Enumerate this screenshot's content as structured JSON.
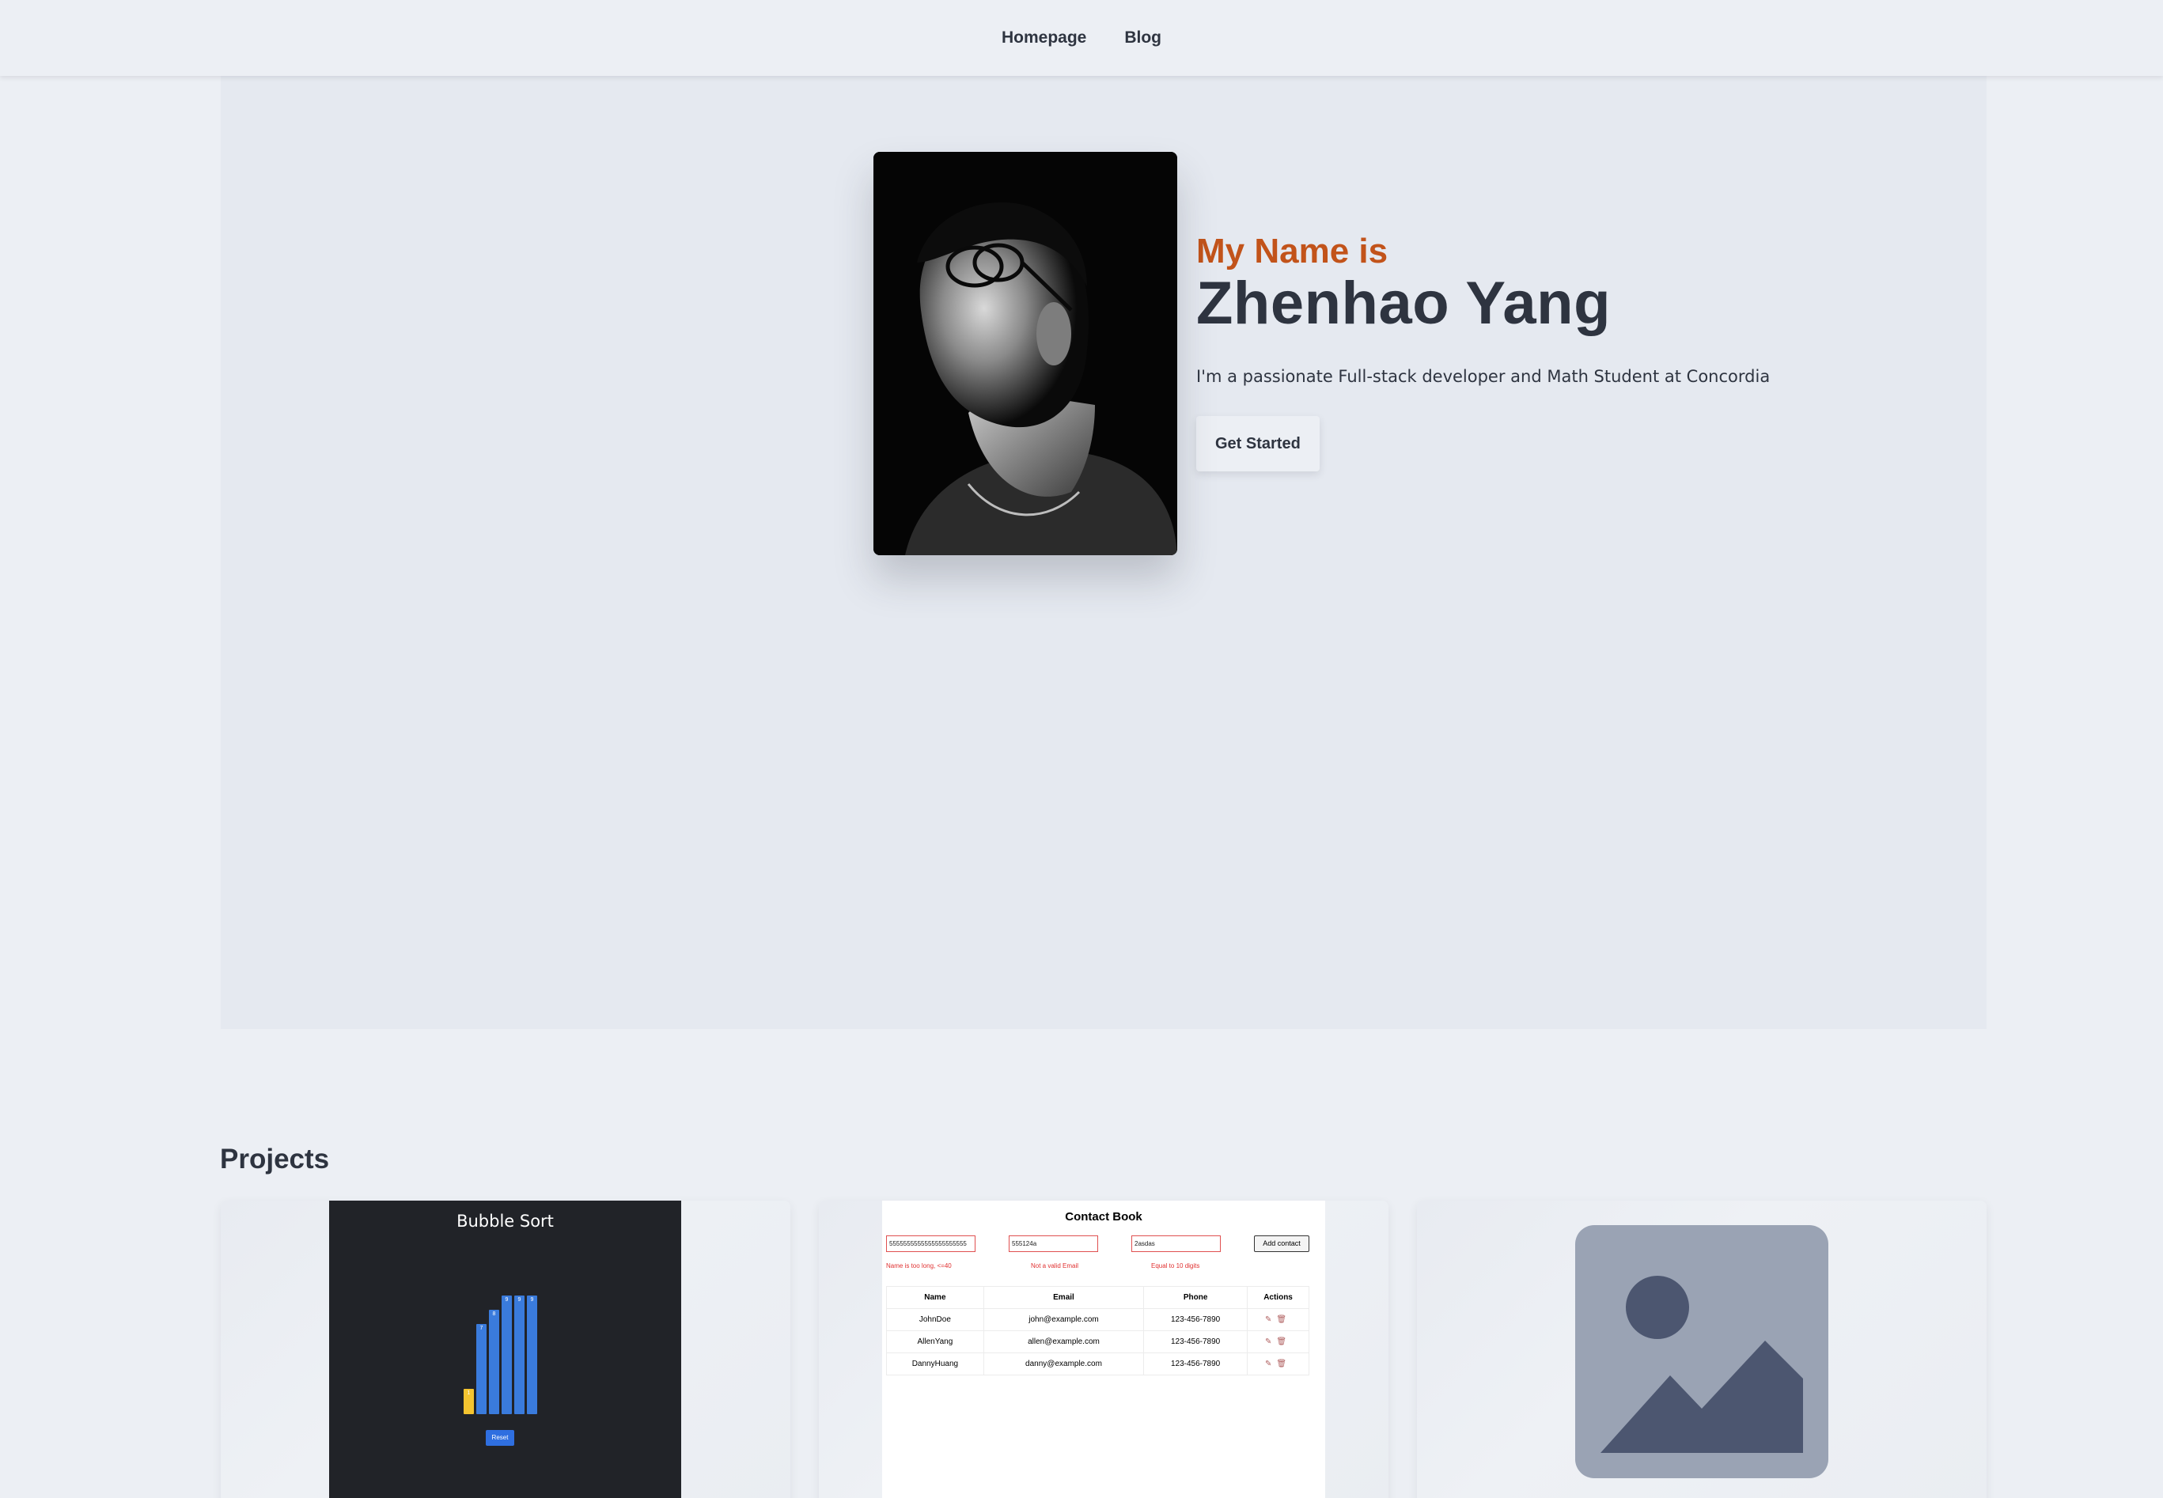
{
  "nav": {
    "items": [
      {
        "label": "Homepage"
      },
      {
        "label": "Blog"
      }
    ]
  },
  "hero": {
    "kicker": "My Name is",
    "name": "Zhenhao Yang",
    "description": "I'm a passionate Full-stack developer and Math Student at Concordia",
    "cta_label": "Get Started"
  },
  "projects": {
    "title": "Projects",
    "cards": [
      {
        "screenshot_title": "Bubble Sort",
        "bars": [
          {
            "value": "1"
          },
          {
            "value": "7"
          },
          {
            "value": "8"
          },
          {
            "value": "9"
          },
          {
            "value": "9"
          },
          {
            "value": "9"
          }
        ],
        "reset_label": "Reset"
      },
      {
        "screenshot_title": "Contact Book",
        "inputs": [
          "5555555555555555555555",
          "555124a",
          "2asdas"
        ],
        "errors": [
          "Name is too long, <=40",
          "Not a valid Email",
          "Equal to 10 digits"
        ],
        "add_label": "Add contact",
        "columns": [
          "Name",
          "Email",
          "Phone",
          "Actions"
        ],
        "rows": [
          {
            "name": "JohnDoe",
            "email": "john@example.com",
            "phone": "123-456-7890"
          },
          {
            "name": "AllenYang",
            "email": "allen@example.com",
            "phone": "123-456-7890"
          },
          {
            "name": "DannyHuang",
            "email": "danny@example.com",
            "phone": "123-456-7890"
          }
        ]
      },
      {
        "image": "image-placeholder-icon"
      }
    ]
  },
  "colors": {
    "page_bg": "#eceff4",
    "hero_bg": "#e5e9f0",
    "accent": "#c2531a",
    "text": "#2e3440",
    "bar": "#3a7bdc",
    "bar_highlight": "#f4c430"
  }
}
